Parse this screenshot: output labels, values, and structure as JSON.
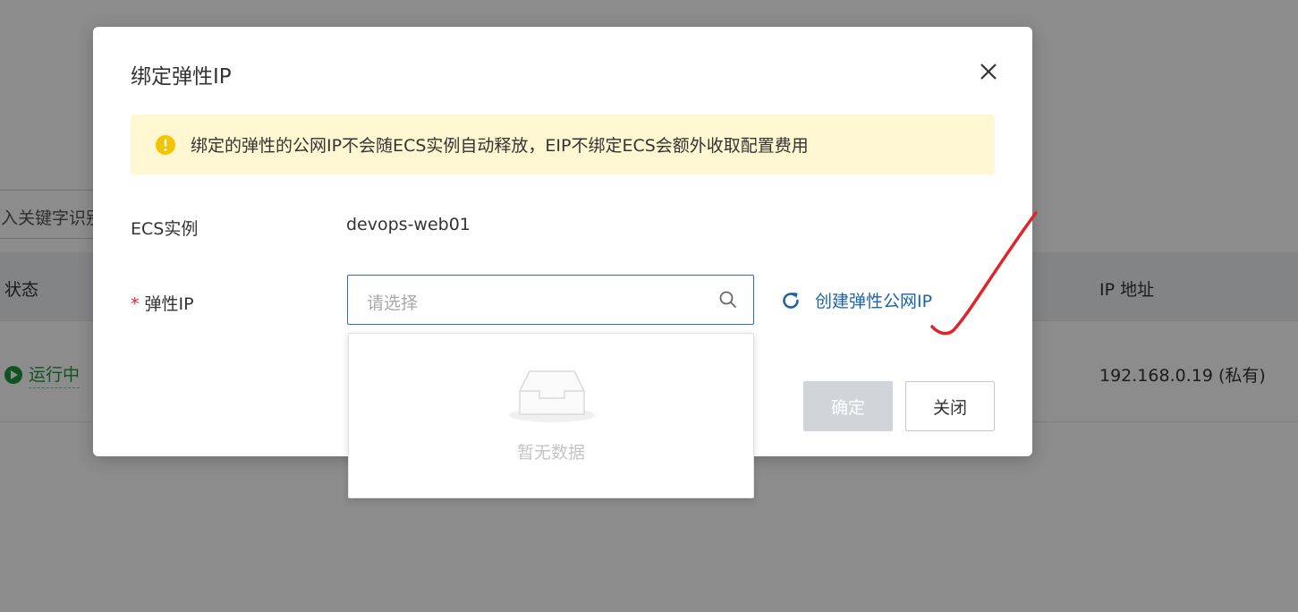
{
  "background": {
    "search_partial": "入关键字识别",
    "table": {
      "col_status": "状态",
      "col_ip": "IP 地址",
      "row": {
        "status": "运行中",
        "ip": "192.168.0.19 (私有)"
      }
    }
  },
  "dialog": {
    "title": "绑定弹性IP",
    "alert": "绑定的弹性的公网IP不会随ECS实例自动释放，EIP不绑定ECS会额外收取配置费用",
    "ecs_label": "ECS实例",
    "ecs_value": "devops-web01",
    "eip_required_mark": "*",
    "eip_label": "弹性IP",
    "select_placeholder": "请选择",
    "create_link": "创建弹性公网IP",
    "ok_label": "确定",
    "close_label": "关闭",
    "dropdown_empty": "暂无数据"
  },
  "colors": {
    "accent": "#2b6fb5",
    "link": "#1e63a8",
    "warning": "#f5c400",
    "running": "#1a9a3d",
    "annotation": "#e0242b"
  },
  "icons": {
    "close": "close-icon",
    "alert": "warning-icon",
    "search": "search-icon",
    "refresh": "refresh-icon",
    "empty": "empty-inbox-icon",
    "running": "play-circle-icon"
  }
}
